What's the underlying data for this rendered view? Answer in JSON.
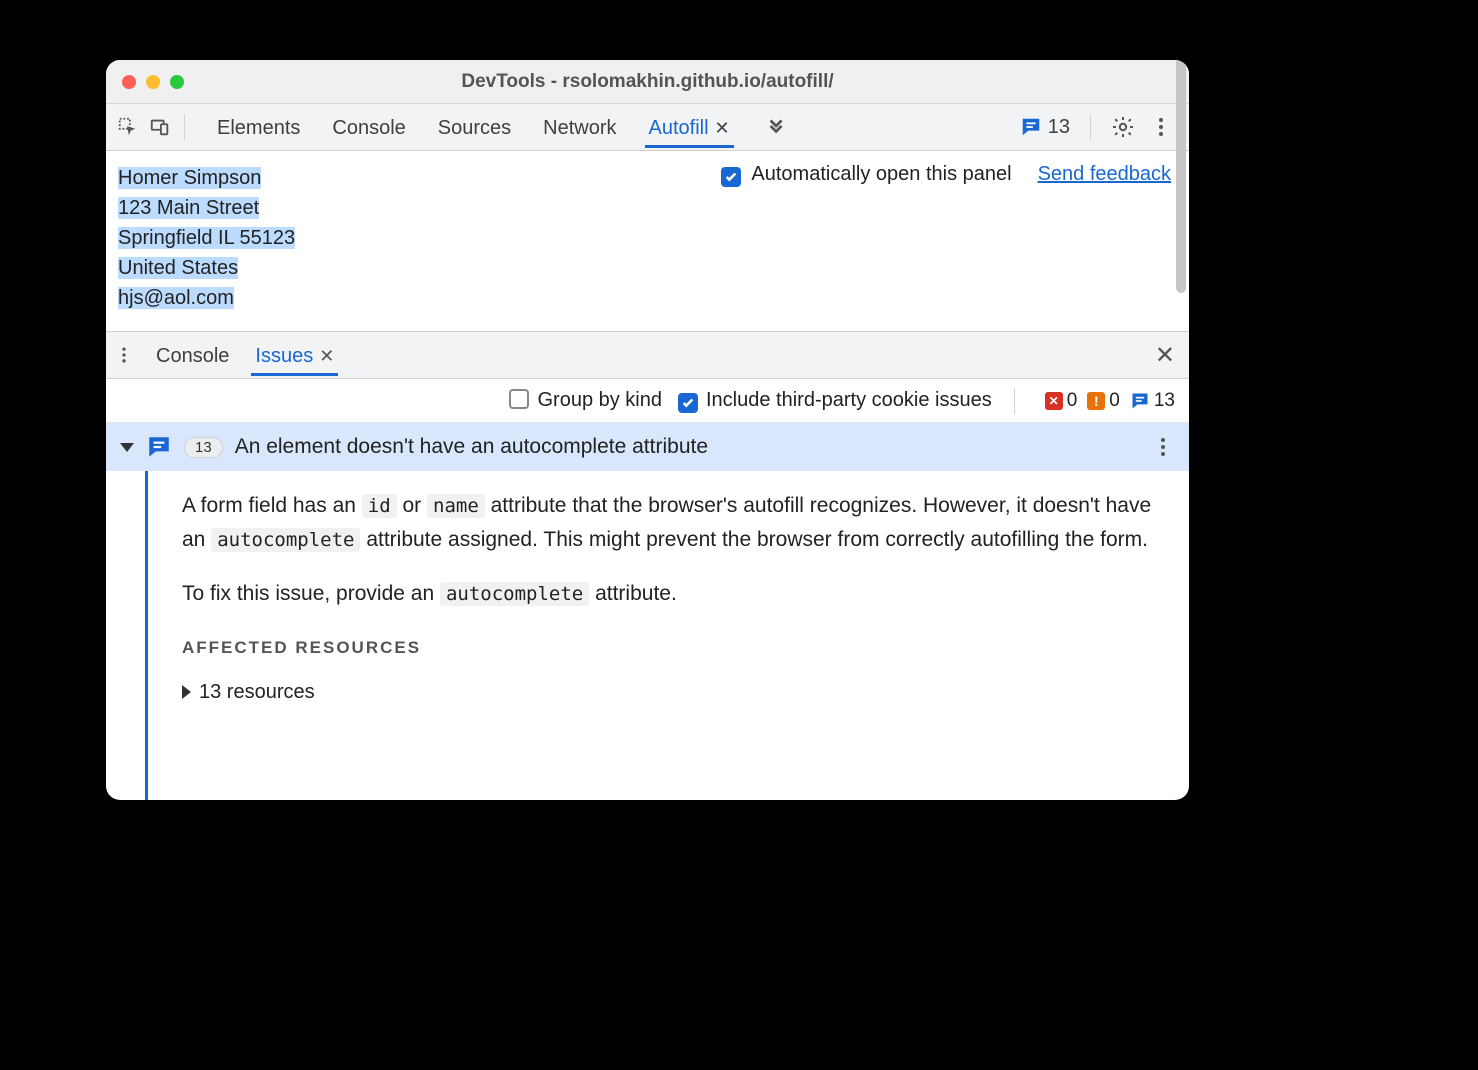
{
  "window": {
    "title": "DevTools - rsolomakhin.github.io/autofill/"
  },
  "main_tabs": {
    "items": [
      "Elements",
      "Console",
      "Sources",
      "Network",
      "Autofill"
    ],
    "active_index": 4
  },
  "toolbar_right": {
    "issue_count": "13"
  },
  "autofill_panel": {
    "lines": [
      "Homer Simpson",
      "123 Main Street",
      "Springfield IL 55123",
      "United States",
      "hjs@aol.com"
    ],
    "auto_open_label": "Automatically open this panel",
    "auto_open_checked": true,
    "feedback_label": "Send feedback"
  },
  "drawer_tabs": {
    "items": [
      "Console",
      "Issues"
    ],
    "active_index": 1
  },
  "issues_toolbar": {
    "group_by_kind_label": "Group by kind",
    "group_by_kind_checked": false,
    "include_3p_label": "Include third-party cookie issues",
    "include_3p_checked": true,
    "counts": {
      "error": "0",
      "warning": "0",
      "info": "13"
    }
  },
  "issue": {
    "count_badge": "13",
    "title": "An element doesn't have an autocomplete attribute",
    "para1_a": "A form field has an ",
    "para1_code1": "id",
    "para1_b": " or ",
    "para1_code2": "name",
    "para1_c": " attribute that the browser's autofill recognizes. However, it doesn't have an ",
    "para1_code3": "autocomplete",
    "para1_d": " attribute assigned. This might prevent the browser from correctly autofilling the form.",
    "para2_a": "To fix this issue, provide an ",
    "para2_code": "autocomplete",
    "para2_b": " attribute.",
    "affected_heading": "AFFECTED RESOURCES",
    "resources_label": "13 resources"
  }
}
